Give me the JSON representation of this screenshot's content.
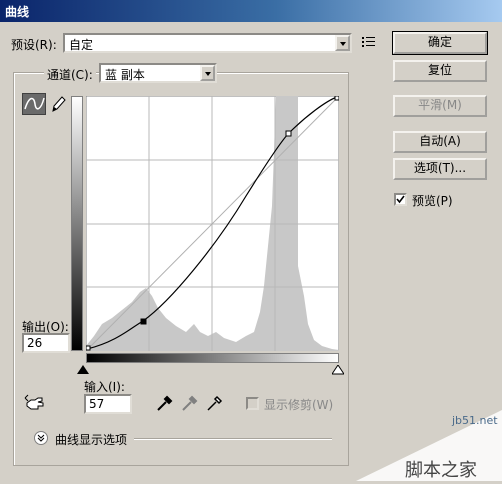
{
  "window": {
    "title": "曲线"
  },
  "preset": {
    "label": "预设(R):",
    "value": "自定",
    "menu_icon": "list-menu-icon"
  },
  "channel": {
    "label": "通道(C):",
    "value": "蓝 副本"
  },
  "buttons": {
    "ok": "确定",
    "reset": "复位",
    "smooth": "平滑(M)",
    "auto": "自动(A)",
    "options": "选项(T)..."
  },
  "preview": {
    "label": "预览(P)",
    "checked": true
  },
  "output": {
    "label": "输出(O):",
    "value": "26"
  },
  "input": {
    "label": "输入(I):",
    "value": "57"
  },
  "show_clipping": {
    "label": "显示修剪(W)",
    "enabled": false
  },
  "curve_display": {
    "label": "曲线显示选项"
  },
  "tools": {
    "curve_tool": "curve-point-icon",
    "pencil_tool": "pencil-icon",
    "hand_tool": "hand-adjust-icon"
  },
  "eyedroppers": [
    "black-eyedropper-icon",
    "gray-eyedropper-icon",
    "white-eyedropper-icon"
  ],
  "curve": {
    "points": [
      [
        0,
        0
      ],
      [
        57,
        26
      ],
      [
        200,
        198
      ],
      [
        255,
        255
      ]
    ]
  },
  "watermark": {
    "site": "jb51.net",
    "brand": "脚本之家"
  }
}
